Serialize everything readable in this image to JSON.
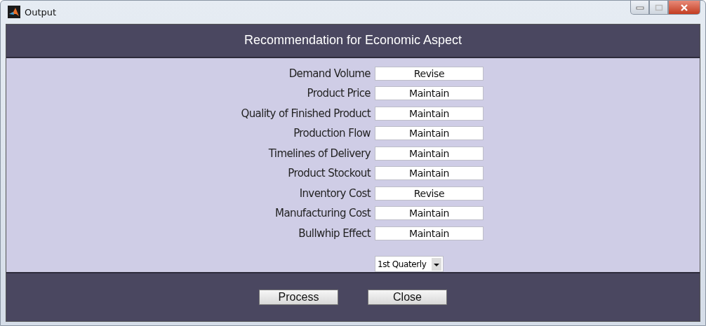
{
  "window": {
    "title": "Output"
  },
  "header": {
    "title": "Recommendation for Economic Aspect"
  },
  "fields": [
    {
      "label": "Demand Volume",
      "value": "Revise"
    },
    {
      "label": "Product Price",
      "value": "Maintain"
    },
    {
      "label": "Quality of Finished Product",
      "value": "Maintain"
    },
    {
      "label": "Production Flow",
      "value": "Maintain"
    },
    {
      "label": "Timelines of Delivery",
      "value": "Maintain"
    },
    {
      "label": "Product Stockout",
      "value": "Maintain"
    },
    {
      "label": "Inventory Cost",
      "value": "Revise"
    },
    {
      "label": "Manufacturing Cost",
      "value": "Maintain"
    },
    {
      "label": "Bullwhip Effect",
      "value": "Maintain"
    }
  ],
  "period_dropdown": {
    "value": "1st Quaterly"
  },
  "buttons": [
    "Process",
    "Close"
  ]
}
